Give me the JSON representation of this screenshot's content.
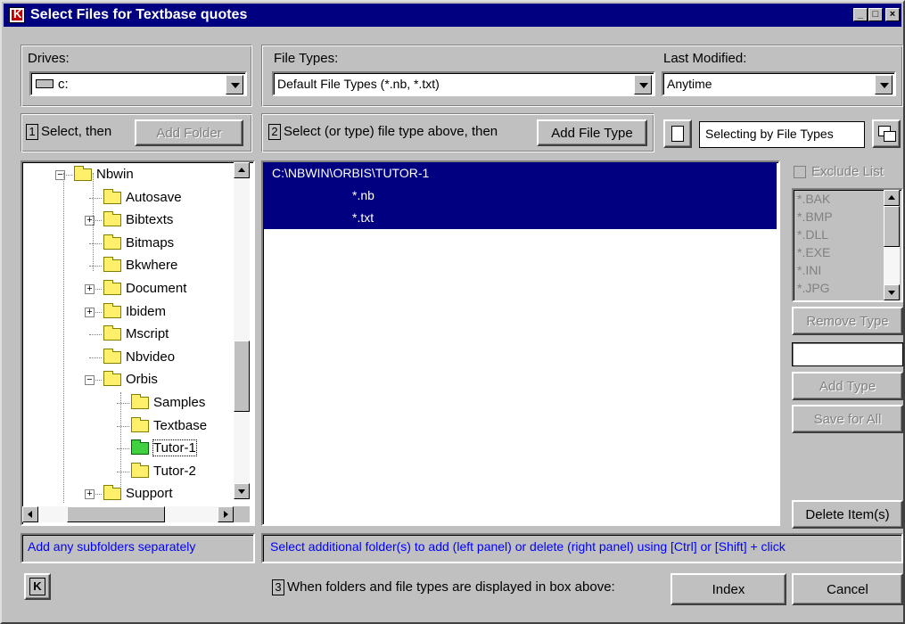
{
  "window": {
    "title": "Select Files for Textbase quotes"
  },
  "drives": {
    "label": "Drives:",
    "value": "c:"
  },
  "file_types": {
    "label": "File Types:",
    "value": "Default File Types (*.nb, *.txt)"
  },
  "last_modified": {
    "label": "Last Modified:",
    "value": "Anytime"
  },
  "step1": {
    "number": "1",
    "text": "Select, then",
    "button": "Add Folder"
  },
  "step2": {
    "number": "2",
    "text": "Select (or type) file type above, then",
    "button": "Add File Type"
  },
  "selecting_mode": "Selecting by File Types",
  "tree": [
    {
      "label": "Nbwin",
      "expander": "minus"
    },
    {
      "label": "Autosave",
      "expander": ""
    },
    {
      "label": "Bibtexts",
      "expander": "plus"
    },
    {
      "label": "Bitmaps",
      "expander": ""
    },
    {
      "label": "Bkwhere",
      "expander": ""
    },
    {
      "label": "Document",
      "expander": "plus"
    },
    {
      "label": "Ibidem",
      "expander": "plus"
    },
    {
      "label": "Mscript",
      "expander": ""
    },
    {
      "label": "Nbvideo",
      "expander": ""
    },
    {
      "label": "Orbis",
      "expander": "minus"
    },
    {
      "label": "Samples",
      "expander": ""
    },
    {
      "label": "Textbase",
      "expander": ""
    },
    {
      "label": "Tutor-1",
      "expander": "",
      "selected": true
    },
    {
      "label": "Tutor-2",
      "expander": ""
    },
    {
      "label": "Support",
      "expander": "plus"
    }
  ],
  "selection_list": [
    "C:\\NBWIN\\ORBIS\\TUTOR-1",
    "*.nb",
    "*.txt"
  ],
  "exclude": {
    "label": "Exclude List",
    "checked": false,
    "items": [
      "*.BAK",
      "*.BMP",
      "*.DLL",
      "*.EXE",
      "*.INI",
      "*.JPG"
    ]
  },
  "buttons": {
    "remove_type": "Remove Type",
    "add_type": "Add Type",
    "save_for_all": "Save for All",
    "delete_items": "Delete Item(s)",
    "index": "Index",
    "cancel": "Cancel"
  },
  "hints": {
    "left": "Add any subfolders separately",
    "right": "Select additional folder(s) to add (left panel) or delete (right panel) using [Ctrl] or [Shift] + click"
  },
  "step3": {
    "number": "3",
    "text": "When folders and file types are displayed in box above:"
  },
  "colors": {
    "titlebar": "#000080",
    "selection": "#000080",
    "hint_text": "#0000ff",
    "face": "#c0c0c0"
  }
}
